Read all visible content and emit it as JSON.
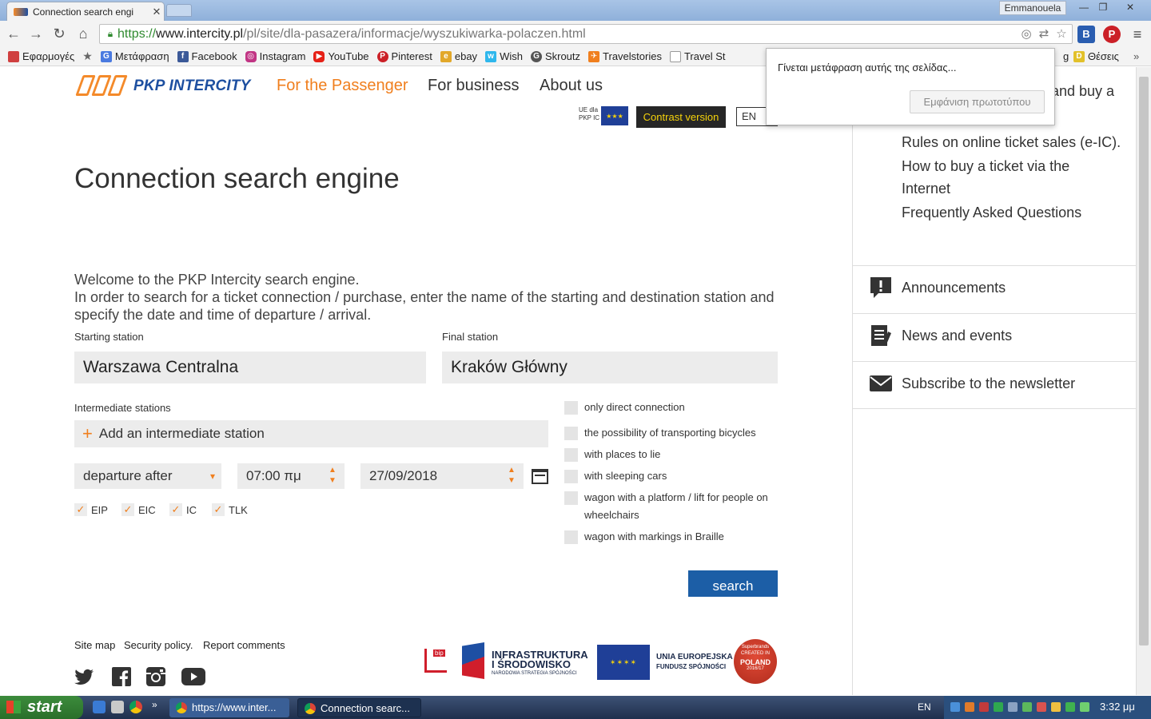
{
  "browser": {
    "tab_title": "Connection search engi",
    "user_name": "Emmanouela",
    "url_scheme": "https://",
    "url_host": "www.intercity.pl",
    "url_path": "/pl/site/dla-pasazera/informacje/wyszukiwarka-polaczen.html"
  },
  "bookmarks": [
    {
      "label": "Εφαρμογές",
      "icon": "apps-icon",
      "color": "#d04040"
    },
    {
      "label": "",
      "icon": "star-icon",
      "color": "#666666"
    },
    {
      "label": "Μετάφραση",
      "icon": "translate-icon",
      "color": "#4a7ae0"
    },
    {
      "label": "Facebook",
      "icon": "facebook-icon",
      "color": "#3b5998"
    },
    {
      "label": "Instagram",
      "icon": "instagram-icon",
      "color": "#c13584"
    },
    {
      "label": "YouTube",
      "icon": "youtube-icon",
      "color": "#e62117"
    },
    {
      "label": "Pinterest",
      "icon": "pinterest-icon",
      "color": "#cb2027"
    },
    {
      "label": "ebay",
      "icon": "ebay-icon",
      "color": "#e2a82a"
    },
    {
      "label": "Wish",
      "icon": "wish-icon",
      "color": "#2fb7ec"
    },
    {
      "label": "Skroutz",
      "icon": "skroutz-icon",
      "color": "#555555"
    },
    {
      "label": "Travelstories",
      "icon": "travel-icon",
      "color": "#f07f1e"
    },
    {
      "label": "Travel St",
      "icon": "page-icon",
      "color": "#999999"
    }
  ],
  "bookmarks_right": [
    {
      "label": "g"
    },
    {
      "label": "Θέσεις"
    }
  ],
  "translate_popup": {
    "message": "Γίνεται μετάφραση αυτής της σελίδας...",
    "button": "Εμφάνιση πρωτοτύπου"
  },
  "site": {
    "logo_name": "PKP INTERCITY",
    "nav": [
      "For the Passenger",
      "For business",
      "About us"
    ],
    "eu_mini_text": "UE dla\nPKP IC",
    "contrast_label": "Contrast version",
    "lang": "EN"
  },
  "main": {
    "title": "Connection search engine",
    "intro_line1": "Welcome to the PKP Intercity search engine.",
    "intro_line2": "In order to search for a ticket connection / purchase, enter the name of the starting and destination station and",
    "intro_line3": "specify the date and time of departure / arrival.",
    "starting_label": "Starting station",
    "starting_value": "Warszawa Centralna",
    "final_label": "Final station",
    "final_value": "Kraków Główny",
    "intermediate_label": "Intermediate stations",
    "add_intermediate": "Add an intermediate station",
    "departure_mode": "departure after",
    "time": "07:00 πμ",
    "date": "27/09/2018",
    "train_types": [
      {
        "label": "EIP",
        "checked": true
      },
      {
        "label": "EIC",
        "checked": true
      },
      {
        "label": "IC",
        "checked": true
      },
      {
        "label": "TLK",
        "checked": true
      }
    ],
    "options": [
      "only direct connection",
      "the possibility of transporting bicycles",
      "with places to lie",
      "with sleeping cars",
      "wagon with a platform / lift for people on wheelchairs",
      "wagon with markings in Braille"
    ],
    "search_label": "search"
  },
  "footer": {
    "links": [
      "Site map",
      "Security policy.",
      "Report comments"
    ],
    "bip": "bip",
    "ii_title_1": "INFRASTRUKTURA",
    "ii_title_2": "I ŚRODOWISKO",
    "ii_sub": "NARODOWA STRATEGIA SPÓJNOŚCI",
    "eu_title": "UNIA EUROPEJSKA",
    "eu_sub": "FUNDUSZ SPÓJNOŚCI",
    "poland_1": "Superbrands",
    "poland_2": "CREATED IN",
    "poland_3": "POLAND",
    "poland_4": "2016/17"
  },
  "sidebar": {
    "partial_link": "and buy a",
    "links": [
      "Rules on online ticket sales (e-IC).",
      "How to buy a ticket via the",
      "Internet",
      "Frequently Asked Questions"
    ],
    "rows": [
      "Announcements",
      "News and events",
      "Subscribe to the newsletter"
    ]
  },
  "taskbar": {
    "start": "start",
    "task1": "https://www.inter...",
    "task2": "Connection searc...",
    "lang": "EN",
    "clock": "3:32 μμ"
  },
  "colors": {
    "accent": "#f07f1e",
    "brand_blue": "#1d4fa0",
    "search_blue": "#1c5ea6"
  }
}
